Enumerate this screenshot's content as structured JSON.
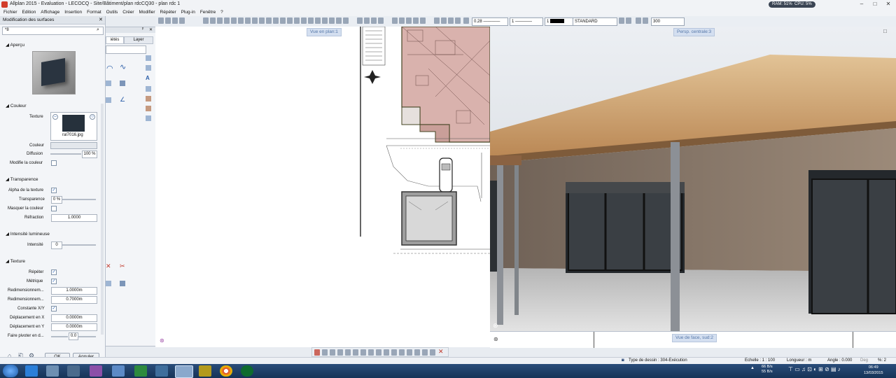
{
  "window": {
    "title": "Allplan 2015 - Evaluation - LECOCQ - Site/Bâtiment/plan rdcCQ30 - plan rdc 1",
    "ram": "RAM: 51%",
    "cpu": "CPU: 5%"
  },
  "menu": [
    "Fichier",
    "Edition",
    "Affichage",
    "Insertion",
    "Format",
    "Outils",
    "Créer",
    "Modifier",
    "Répéter",
    "Plug-in",
    "Fenêtre",
    "?"
  ],
  "toolbar": {
    "pen": "0.28",
    "line": "1",
    "color": "1",
    "layer": "STANDARD",
    "scale": "300"
  },
  "panel": {
    "title": "Modification des surfaces",
    "search": "*8",
    "sections": {
      "preview": "Aperçu",
      "color": "Couleur",
      "transparency": "Transparence",
      "light": "Intensité lumineuse",
      "texture": "Texture"
    },
    "texture_label": "Texture",
    "texture_file": "ral7016.jpg",
    "color_label": "Couleur",
    "diffusion_label": "Diffusion",
    "diffusion_value": "100 %",
    "modify_color_label": "Modifie la couleur",
    "alpha_label": "Alpha de la texture",
    "transparency_label": "Transparence",
    "transparency_value": "0 %",
    "mask_color_label": "Masquer la couleur",
    "refraction_label": "Réfraction",
    "refraction_value": "1.0000",
    "intensity_label": "Intensité",
    "intensity_value": "0",
    "repeat_label": "Répéter",
    "metric_label": "Métrique",
    "resize1_label": "Redimensionnem...",
    "resize1_value": "1.0000m",
    "resize2_label": "Redimensionnem...",
    "resize2_value": "0.7000m",
    "constant_label": "Constante X/Y",
    "offx_label": "Déplacement en X",
    "offx_value": "0.0000m",
    "offy_label": "Déplacement en Y",
    "offy_value": "0.0000m",
    "rotate_label": "Faire pivoter en d...",
    "rotate_value": "0.0",
    "ok": "OK",
    "cancel": "Annuler"
  },
  "palette2": {
    "tab1": "iétés",
    "tab2": "Layer"
  },
  "viewports": {
    "plan": "Vue en plan:1",
    "persp": "Persp. centrale:3",
    "front": "Vue de face, sud:2"
  },
  "status": {
    "drawing_type": "Type de dessin : 304-Exécution",
    "scale": "Echelle : 1 : 100",
    "length": "Longueur : m",
    "angle": "Angle : 0.000",
    "deg": "Deg",
    "percent": "%: 2"
  },
  "taskbar": {
    "time": "06:49",
    "date": "13/03/2015",
    "net1": "66 B/s",
    "net2": "55 B/s"
  },
  "colors": {
    "titlebar": "#f1f3f6",
    "panel": "#f3f5f8",
    "taskbar": "#1f416b",
    "roof": "#c79a66",
    "wall": "#8d7c6c"
  }
}
